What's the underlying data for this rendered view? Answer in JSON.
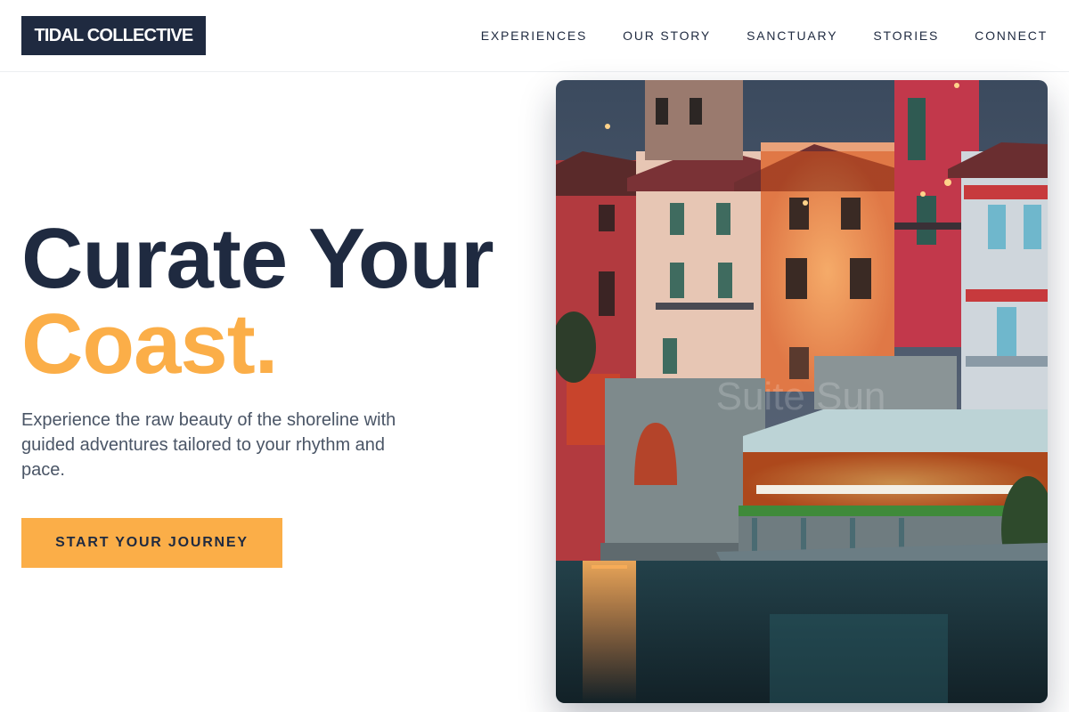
{
  "brand": {
    "logo_text": "TIDAL COLLECTIVE"
  },
  "nav": {
    "items": [
      {
        "label": "EXPERIENCES"
      },
      {
        "label": "OUR STORY"
      },
      {
        "label": "SANCTUARY"
      },
      {
        "label": "STORIES"
      },
      {
        "label": "CONNECT"
      }
    ]
  },
  "hero": {
    "title_line1": "Curate Your",
    "title_line2": "Coast.",
    "subtitle": "Experience the raw beauty of the shoreline with guided adventures tailored to your rhythm and pace.",
    "cta_label": "START YOUR JOURNEY",
    "image_alt": "Colorful lakeside village at dusk with a lit waterfront restaurant terrace",
    "watermark": "Suite Sun"
  },
  "colors": {
    "navy": "#1f2a40",
    "accent": "#fbae48",
    "body_text": "#4a5566"
  }
}
